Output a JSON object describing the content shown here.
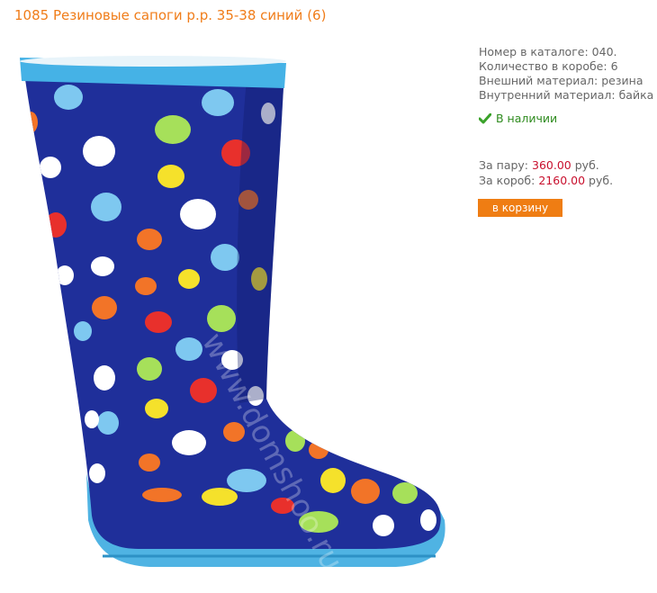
{
  "product": {
    "title": "1085 Резиновые сапоги р.р. 35-38 синий (6)",
    "image_alt": "Резиновые сапоги синие в горошек",
    "watermark": "www.domshoo.ru"
  },
  "details": [
    {
      "label": "Номер в каталоге:",
      "value": "040."
    },
    {
      "label": "Количество в коробе:",
      "value": "6"
    },
    {
      "label": "Внешний материал:",
      "value": "резина"
    },
    {
      "label": "Внутренний материал:",
      "value": "байка"
    }
  ],
  "stock": {
    "icon": "check-icon",
    "label": "В наличии",
    "color": "#2e8b1e"
  },
  "prices": {
    "per_pair": {
      "label": "За пару:",
      "value": "360.00",
      "currency": "руб."
    },
    "per_box": {
      "label": "За короб:",
      "value": "2160.00",
      "currency": "руб."
    }
  },
  "cart_button": {
    "label": "в корзину",
    "color": "#ef7d13"
  },
  "colors": {
    "title": "#f07d1a",
    "price": "#c8102e",
    "boot_body": "#1f2f9a",
    "boot_trim": "#45b2e6"
  }
}
